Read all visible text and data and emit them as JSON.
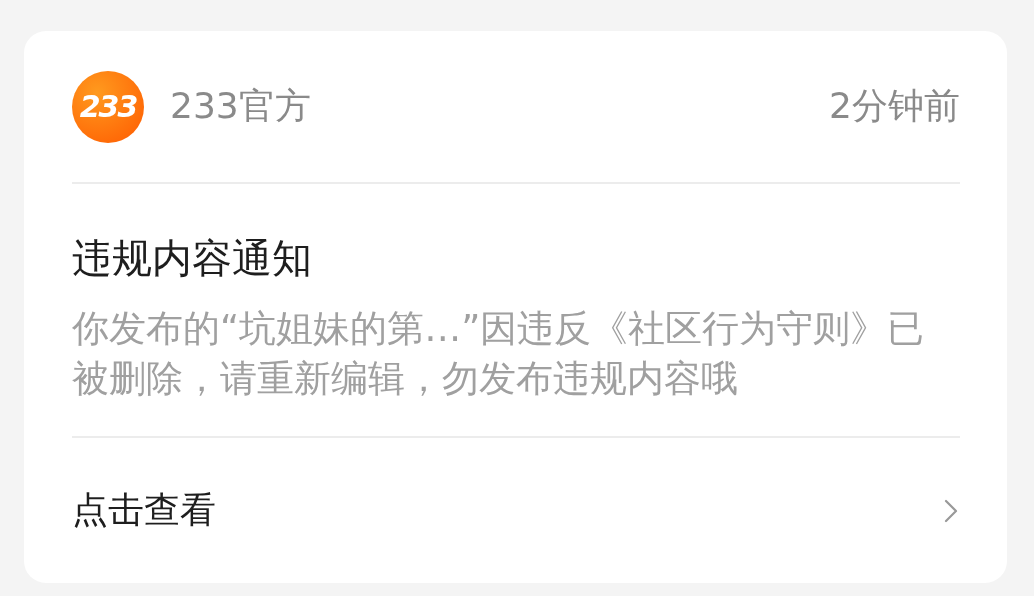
{
  "notification": {
    "sender": {
      "logo_text": "233",
      "name": "233官方"
    },
    "time": "2分钟前",
    "title": "违规内容通知",
    "body": "你发布的“坑姐妹的第…”因违反《社区行为守则》已被删除，请重新编辑，勿发布违规内容哦",
    "action": "点击查看"
  }
}
